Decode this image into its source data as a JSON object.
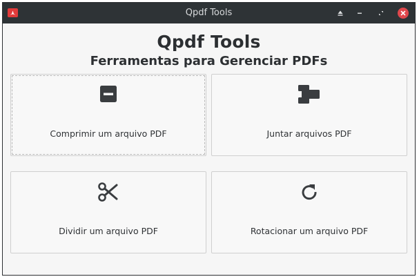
{
  "window": {
    "title": "Qpdf Tools",
    "app_icon": "pdf-icon",
    "controls": [
      "keep-above-icon",
      "minimize-icon",
      "maximize-icon",
      "close-icon"
    ]
  },
  "header": {
    "title": "Qpdf Tools",
    "subtitle": "Ferramentas para Gerenciar PDFs"
  },
  "tools": [
    {
      "label": "Comprimir um arquivo PDF",
      "icon": "compress-icon"
    },
    {
      "label": "Juntar arquivos PDF",
      "icon": "merge-icon"
    },
    {
      "label": "Dividir um arquivo PDF",
      "icon": "scissors-icon"
    },
    {
      "label": "Rotacionar um arquivo PDF",
      "icon": "rotate-icon"
    }
  ],
  "colors": {
    "titlebar": "#2e3336",
    "close_button": "#e0474c",
    "app_icon": "#e23b3b",
    "icon": "#3a3d40"
  }
}
